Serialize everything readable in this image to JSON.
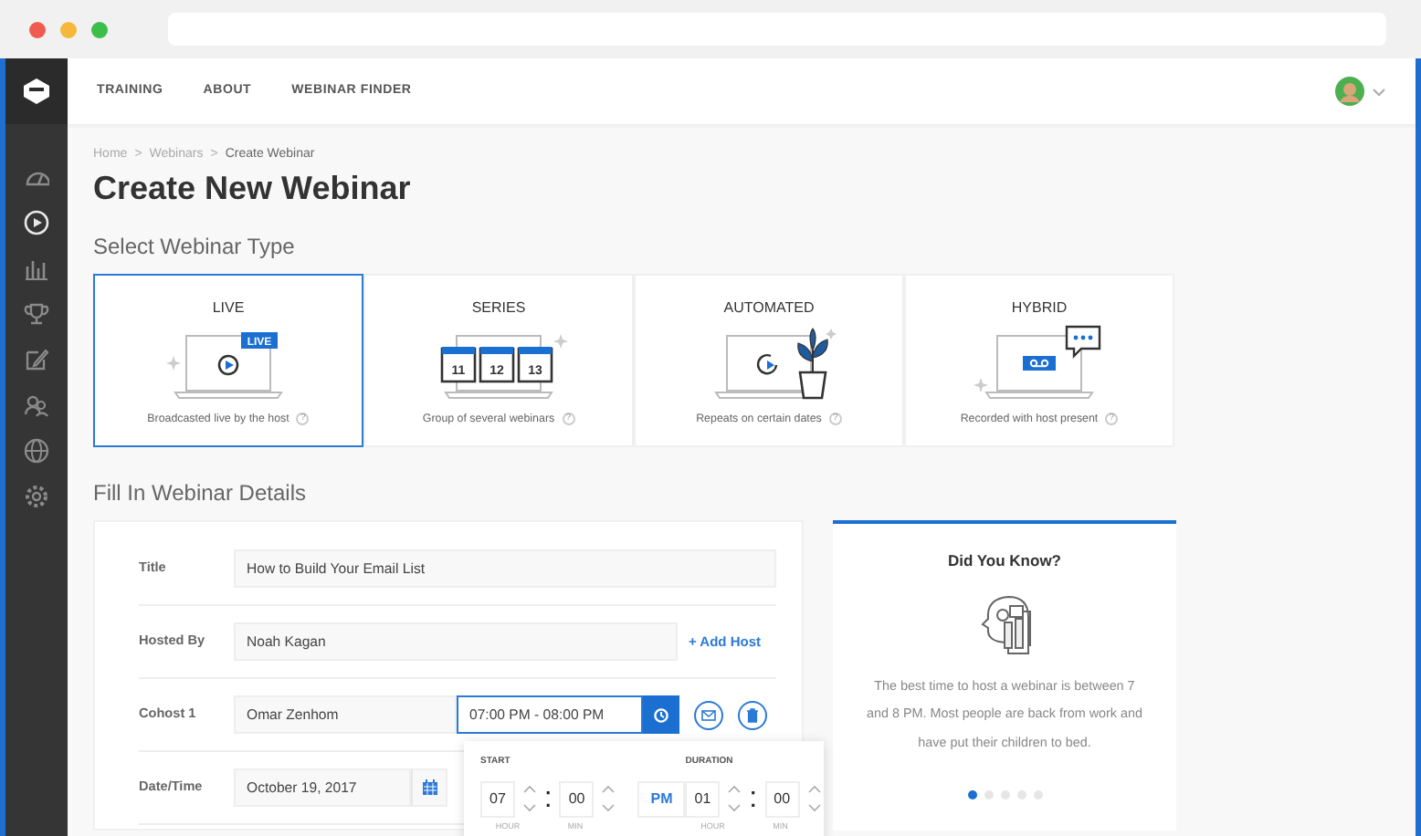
{
  "nav": [
    {
      "label": "TRAINING"
    },
    {
      "label": "ABOUT"
    },
    {
      "label": "WEBINAR FINDER"
    }
  ],
  "sidebar": {
    "items": [
      {
        "kind": "dashboard",
        "selected": false
      },
      {
        "kind": "play",
        "selected": true
      },
      {
        "kind": "chart",
        "selected": false
      },
      {
        "kind": "trophy",
        "selected": false
      },
      {
        "kind": "edit",
        "selected": false
      },
      {
        "kind": "users",
        "selected": false
      },
      {
        "kind": "globe",
        "selected": false
      },
      {
        "kind": "settings",
        "selected": false
      }
    ]
  },
  "breadcrumb": {
    "separator": ">",
    "items": [
      "Home",
      "Webinars",
      "Create Webinar"
    ]
  },
  "title": "Create New Webinar",
  "webinar_types": {
    "heading": "Select Webinar Type",
    "types": [
      {
        "kind": "live",
        "label": "LIVE",
        "badge": "LIVE",
        "description": "Broadcasted live by the host",
        "help": "?",
        "selected": true
      },
      {
        "kind": "series",
        "label": "SERIES",
        "dates": [
          "11",
          "12",
          "13"
        ],
        "description": "Group of several webinars",
        "help": "?",
        "selected": false
      },
      {
        "kind": "automated",
        "label": "AUTOMATED",
        "description": "Repeats on certain dates",
        "help": "?",
        "selected": false
      },
      {
        "kind": "hybrid",
        "label": "HYBRID",
        "description": "Recorded with host present",
        "help": "?",
        "selected": false
      }
    ]
  },
  "details": {
    "heading": "Fill In Webinar Details",
    "fields": [
      {
        "kind": "text",
        "label": "Title",
        "value": "How to Build Your Email List"
      },
      {
        "kind": "host",
        "label": "Hosted By",
        "value": "Noah Kagan",
        "link": "+ Add Host"
      },
      {
        "kind": "cohost",
        "label": "Cohost 1",
        "value": "Omar Zenhom",
        "time": "07:00 PM - 08:00 PM"
      },
      {
        "kind": "date",
        "label": "Date/Time",
        "value": "October 19, 2017"
      }
    ]
  },
  "time_picker": {
    "separator": ":",
    "start": {
      "label": "START",
      "hour": "07",
      "minute": "00",
      "period": "PM",
      "units": [
        "HOUR",
        "MIN"
      ]
    },
    "duration": {
      "label": "DURATION",
      "hour": "01",
      "minute": "00",
      "units": [
        "HOUR",
        "MIN"
      ]
    }
  },
  "tip": {
    "heading": "Did You Know?",
    "text": "The best time to host a webinar is between 7 and 8 PM. Most people are back from work and have put their children to bed.",
    "dots": [
      {
        "selected": true
      },
      {
        "selected": false
      },
      {
        "selected": false
      },
      {
        "selected": false
      },
      {
        "selected": false
      }
    ]
  }
}
